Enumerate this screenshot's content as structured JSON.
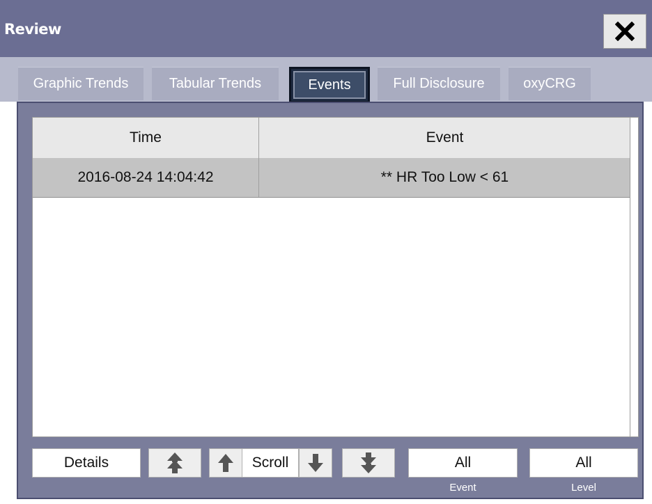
{
  "window": {
    "title": "Review",
    "close_icon": "close-icon"
  },
  "tabs": [
    {
      "label": "Graphic Trends",
      "active": false
    },
    {
      "label": "Tabular Trends",
      "active": false
    },
    {
      "label": "Events",
      "active": true
    },
    {
      "label": "Full Disclosure",
      "active": false
    },
    {
      "label": "oxyCRG",
      "active": false
    }
  ],
  "table": {
    "columns": [
      "Time",
      "Event"
    ],
    "rows": [
      {
        "time": "2016-08-24 14:04:42",
        "event": "** HR Too Low < 61"
      }
    ]
  },
  "toolbar": {
    "details_label": "Details",
    "page_up_icon": "double-arrow-up-icon",
    "up_icon": "arrow-up-icon",
    "scroll_label": "Scroll",
    "down_icon": "arrow-down-icon",
    "page_down_icon": "double-arrow-down-icon",
    "event_filter": {
      "value": "All",
      "caption": "Event"
    },
    "level_filter": {
      "value": "All",
      "caption": "Level"
    }
  },
  "colors": {
    "title_bar": "#6b6e93",
    "panel": "#7a7d9b",
    "active_tab": "#3d4d68",
    "selected_row": "#c3c3c3"
  }
}
